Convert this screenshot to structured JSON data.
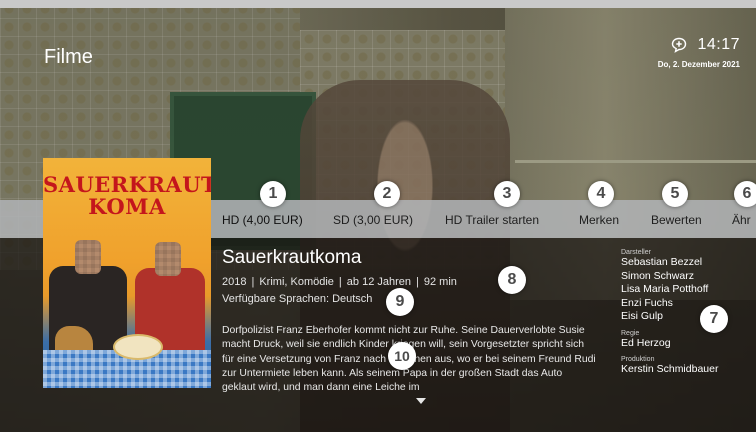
{
  "header": {
    "page_title": "Filme",
    "time": "14:17",
    "date": "Do, 2. Dezember 2021",
    "message_icon": "message-bubble-icon"
  },
  "menu": {
    "items": [
      {
        "label": "HD (4,00 EUR)"
      },
      {
        "label": "SD (3,00 EUR)"
      },
      {
        "label": "HD Trailer starten"
      },
      {
        "label": "Merken"
      },
      {
        "label": "Bewerten"
      },
      {
        "label": "Ähr"
      }
    ]
  },
  "poster": {
    "title_line1": "SAUERKRAUT",
    "title_line2": "KOMA"
  },
  "movie": {
    "title": "Sauerkrautkoma",
    "year": "2018",
    "genre": "Krimi, Komödie",
    "age_rating": "ab 12 Jahren",
    "duration": "92 min",
    "languages": "Verfügbare Sprachen: Deutsch",
    "synopsis": "Dorfpolizist Franz Eberhofer kommt nicht zur Ruhe. Seine Dauerverlobte Susie macht Druck, weil sie endlich Kinder kriegen will, sein Vorgesetzter spricht sich für eine Versetzung von Franz nach München aus, wo er bei seinem Freund Rudi zur Untermiete leben kann. Als seinem Papa in der großen Stadt das Auto geklaut wird, und man dann eine Leiche im"
  },
  "credits": {
    "cast_label": "Darsteller",
    "cast": [
      "Sebastian Bezzel",
      "Simon Schwarz",
      "Lisa Maria Potthoff",
      "Enzi Fuchs",
      "Eisi Gulp"
    ],
    "director_label": "Regie",
    "director": "Ed Herzog",
    "production_label": "Produktion",
    "producer": "Kerstin Schmidbauer"
  },
  "callouts": [
    "1",
    "2",
    "3",
    "4",
    "5",
    "6",
    "7",
    "8",
    "9",
    "10"
  ],
  "colors": {
    "menu_bar": "#afb2b4",
    "poster_title": "#c4161c",
    "callout_bg": "#ffffff"
  }
}
